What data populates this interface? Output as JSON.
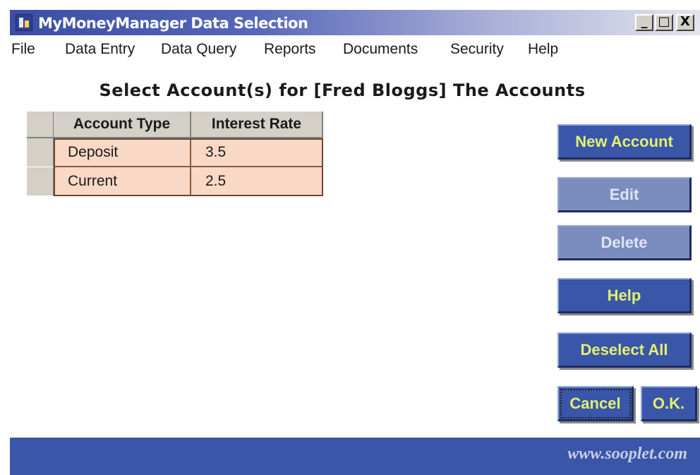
{
  "window": {
    "title": "MyMoneyManager Data Selection",
    "controls": {
      "minimize": "_",
      "maximize": "□",
      "close": "X"
    }
  },
  "menu": [
    "File",
    "Data Entry",
    "Data Query",
    "Reports",
    "Documents",
    "Security",
    "Help"
  ],
  "heading": "Select Account(s) for [Fred Bloggs] The Accounts",
  "table": {
    "columns": [
      "Account Type",
      "Interest Rate"
    ],
    "rows": [
      [
        "Deposit",
        "3.5"
      ],
      [
        "Current",
        "2.5"
      ]
    ]
  },
  "buttons": {
    "new_account": "New Account",
    "edit": "Edit",
    "delete": "Delete",
    "help": "Help",
    "deselect_all": "Deselect All",
    "cancel": "Cancel",
    "ok": "O.K."
  },
  "footer": {
    "url": "www.sooplet.com"
  },
  "colors": {
    "accent": "#3a56a8",
    "button_text": "#e4f070",
    "row_fill": "#f9d8c6"
  }
}
